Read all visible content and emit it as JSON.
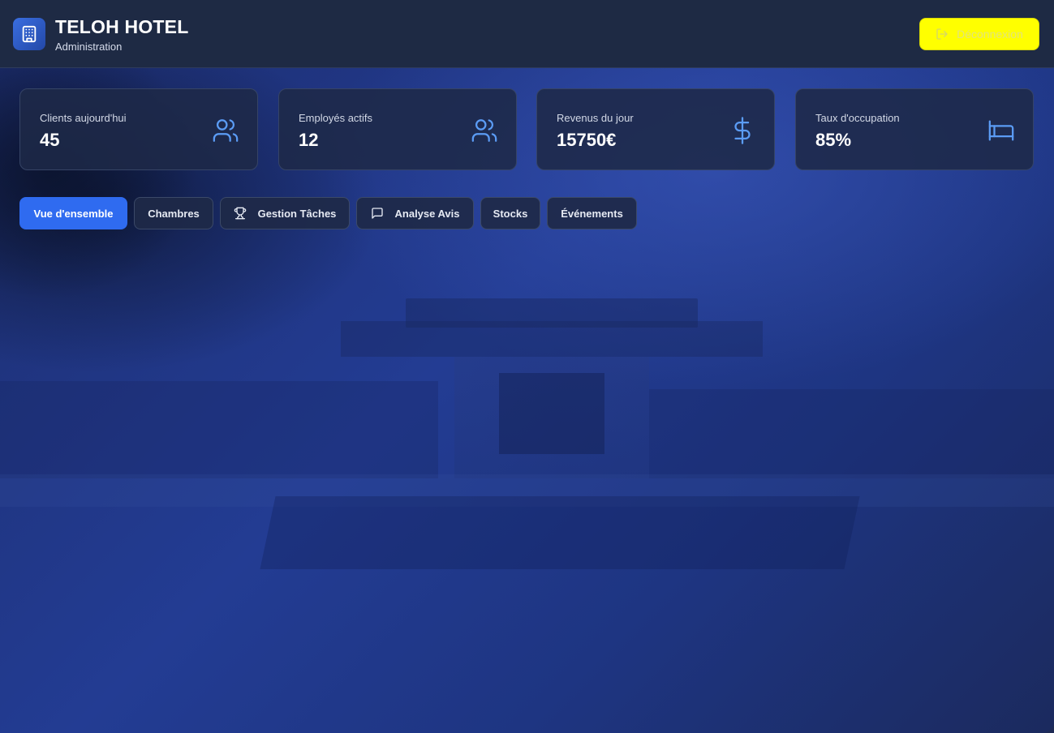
{
  "header": {
    "title": "TELOH HOTEL",
    "subtitle": "Administration",
    "logo_icon": "building-icon",
    "logout_label": "Déconnexion",
    "logout_icon": "logout-icon",
    "logout_bg": "#ffff00"
  },
  "stats": [
    {
      "label": "Clients aujourd'hui",
      "value": "45",
      "icon": "users-icon"
    },
    {
      "label": "Employés actifs",
      "value": "12",
      "icon": "users-icon"
    },
    {
      "label": "Revenus du jour",
      "value": "15750€",
      "icon": "dollar-icon"
    },
    {
      "label": "Taux d'occupation",
      "value": "85%",
      "icon": "bed-icon"
    }
  ],
  "tabs": [
    {
      "label": "Vue d'ensemble",
      "active": true
    },
    {
      "label": "Chambres"
    },
    {
      "label": "Gestion Tâches",
      "icon": "trophy-icon"
    },
    {
      "label": "Analyse Avis",
      "icon": "message-icon"
    },
    {
      "label": "Stocks"
    },
    {
      "label": "Événements"
    }
  ],
  "colors": {
    "accent": "#2f6bf0",
    "icon": "#5b9cf5",
    "card_bg": "#1e2948",
    "header_bg": "#1e2a44"
  }
}
